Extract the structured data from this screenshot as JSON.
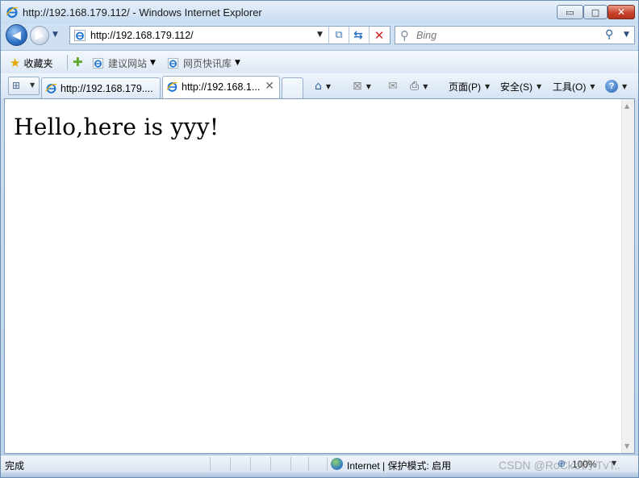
{
  "window": {
    "title": "http://192.168.179.112/ - Windows Internet Explorer",
    "minimize_glyph": "▭",
    "maximize_glyph": "□",
    "close_glyph": "✕"
  },
  "navigation": {
    "back_icon": "back-arrow-icon",
    "forward_icon": "forward-arrow-icon",
    "address_url": "http://192.168.179.112/",
    "search_placeholder": "Bing"
  },
  "favorites_bar": {
    "favorites_label": "收藏夹",
    "items": [
      {
        "label": "建议网站"
      },
      {
        "label": "网页快讯库"
      }
    ]
  },
  "tabs": [
    {
      "label": "http://192.168.179....",
      "active": false
    },
    {
      "label": "http://192.168.1...",
      "active": true
    }
  ],
  "command_bar": {
    "page_label": "页面(P)",
    "safety_label": "安全(S)",
    "tools_label": "工具(O)",
    "help_glyph": "?"
  },
  "content": {
    "heading": "Hello,here is yyy!"
  },
  "status_bar": {
    "status": "完成",
    "zone": "Internet | 保护模式: 启用",
    "zoom": "100%",
    "watermark": "CSDN @RoCkU的 TvT.."
  },
  "colors": {
    "chrome": "#cfe1f3",
    "close_button": "#c9432c",
    "accent": "#2d6fc2"
  }
}
